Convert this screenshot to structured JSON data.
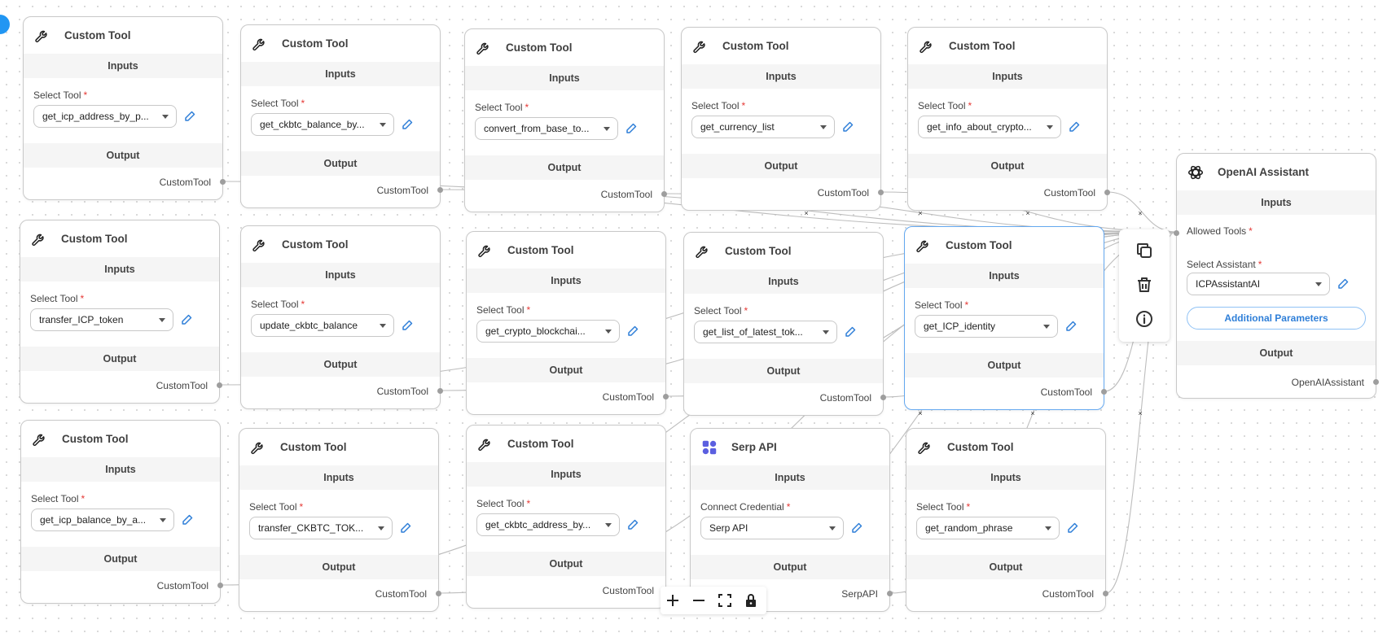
{
  "canvas": {
    "accent": "#2196f3",
    "selected_border": "#64a8f0",
    "required_color": "#e53935"
  },
  "common": {
    "inputs_label": "Inputs",
    "output_label": "Output",
    "select_tool_label": "Select Tool",
    "required_mark": "*"
  },
  "nodes": [
    {
      "title": "Custom Tool",
      "tool": "get_icp_address_by_p...",
      "output": "CustomTool"
    },
    {
      "title": "Custom Tool",
      "tool": "get_ckbtc_balance_by...",
      "output": "CustomTool"
    },
    {
      "title": "Custom Tool",
      "tool": "convert_from_base_to...",
      "output": "CustomTool"
    },
    {
      "title": "Custom Tool",
      "tool": "get_currency_list",
      "output": "CustomTool"
    },
    {
      "title": "Custom Tool",
      "tool": "get_info_about_crypto...",
      "output": "CustomTool"
    },
    {
      "title": "Custom Tool",
      "tool": "transfer_ICP_token",
      "output": "CustomTool"
    },
    {
      "title": "Custom Tool",
      "tool": "update_ckbtc_balance",
      "output": "CustomTool"
    },
    {
      "title": "Custom Tool",
      "tool": "get_crypto_blockchai...",
      "output": "CustomTool"
    },
    {
      "title": "Custom Tool",
      "tool": "get_list_of_latest_tok...",
      "output": "CustomTool"
    },
    {
      "title": "Custom Tool",
      "tool": "get_ICP_identity",
      "output": "CustomTool"
    },
    {
      "title": "Custom Tool",
      "tool": "get_icp_balance_by_a...",
      "output": "CustomTool"
    },
    {
      "title": "Custom Tool",
      "tool": "transfer_CKBTC_TOK...",
      "output": "CustomTool"
    },
    {
      "title": "Custom Tool",
      "tool": "get_ckbtc_address_by...",
      "output": "CustomTool"
    },
    {
      "title": "Serp API",
      "field_label": "Connect Credential",
      "tool": "Serp API",
      "output": "SerpAPI",
      "icon": "serp-api-logo"
    },
    {
      "title": "Custom Tool",
      "tool": "get_random_phrase",
      "output": "CustomTool"
    }
  ],
  "assistant": {
    "title": "OpenAI Assistant",
    "inputs_label": "Inputs",
    "allowed_tools_label": "Allowed Tools",
    "select_assistant_label": "Select Assistant",
    "assistant_value": "ICPAssistantAI",
    "additional_params_label": "Additional Parameters",
    "output_label": "Output",
    "output_name": "OpenAIAssistant",
    "icon": "openai-icon"
  },
  "node_actions": [
    "copy-icon",
    "delete-icon",
    "info-icon"
  ],
  "controls": [
    "zoom-in-icon",
    "zoom-out-icon",
    "fit-view-icon",
    "lock-icon"
  ]
}
